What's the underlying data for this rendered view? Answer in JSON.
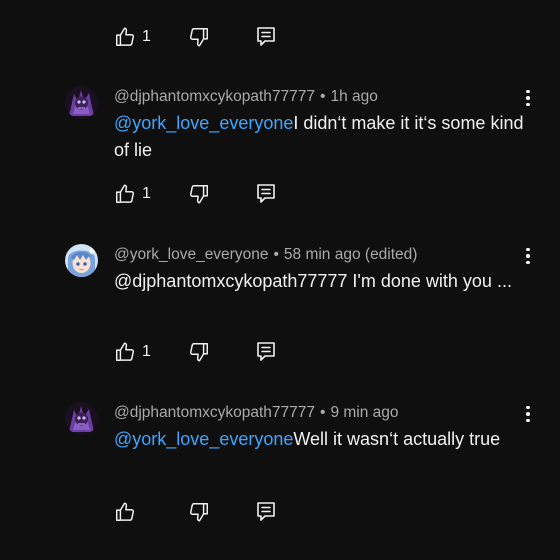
{
  "top_actions": {
    "like_count": "1"
  },
  "comments": [
    {
      "author": "@djphantomxcykopath77777",
      "separator": "•",
      "time": "1h ago",
      "mention": "@york_love_everyone",
      "text": "I didn‘t make it it‘s some kind of lie",
      "like_count": "1",
      "avatar": "purple-skull-avatar"
    },
    {
      "author": "@york_love_everyone",
      "separator": "•",
      "time": "58 min ago (edited)",
      "mention": "",
      "text": "@djphantomxcykopath77777 I'm done with you ...",
      "like_count": "1",
      "avatar": "anime-character-avatar"
    },
    {
      "author": "@djphantomxcykopath77777",
      "separator": "•",
      "time": "9 min ago",
      "mention": "@york_love_everyone",
      "text": "Well it wasn‘t actually true",
      "like_count": "",
      "avatar": "purple-skull-avatar"
    }
  ],
  "icons": {
    "like": "thumbs-up-icon",
    "dislike": "thumbs-down-icon",
    "reply": "reply-comment-icon",
    "menu": "more-vertical-icon"
  },
  "colors": {
    "background": "#0f0f0f",
    "text": "#f1f1f1",
    "meta": "#aaaaaa",
    "mention": "#3ea6ff"
  }
}
